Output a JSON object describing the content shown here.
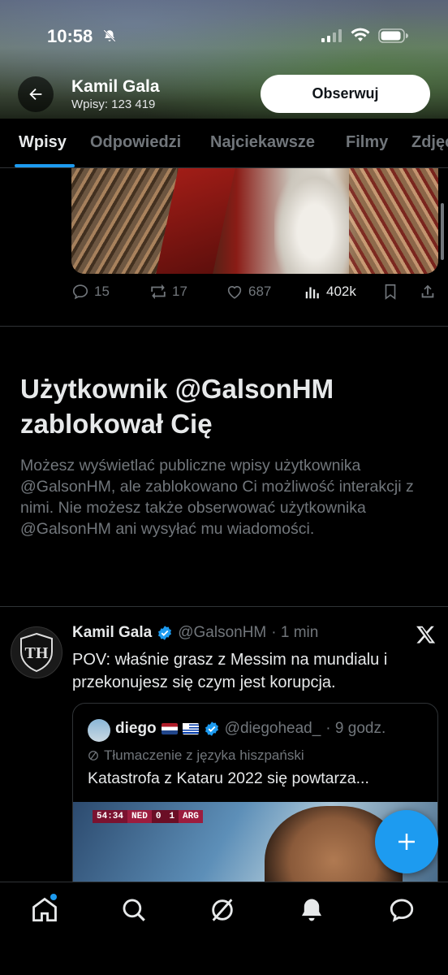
{
  "status_bar": {
    "time": "10:58"
  },
  "header": {
    "profile_name": "Kamil Gala",
    "post_count": "Wpisy: 123 419",
    "follow_label": "Obserwuj"
  },
  "tabs": [
    {
      "label": "Wpisy",
      "active": true
    },
    {
      "label": "Odpowiedzi",
      "active": false
    },
    {
      "label": "Najciekawsze",
      "active": false
    },
    {
      "label": "Filmy",
      "active": false
    },
    {
      "label": "Zdjęcia",
      "active": false
    }
  ],
  "first_post": {
    "replies": "15",
    "reposts": "17",
    "likes": "687",
    "views": "402k"
  },
  "blocked_notice": {
    "title": "Użytkownik @GalsonHM zablokował Cię",
    "body": "Możesz wyświetlać publiczne wpisy użytkownika @GalsonHM, ale zablokowano Ci możliwość interakcji z nimi. Nie możesz także obserwować użytkownika @GalsonHM ani wysyłać mu wiadomości."
  },
  "second_post": {
    "author_name": "Kamil Gala",
    "handle": "@GalsonHM",
    "time": "· 1 min",
    "text": "POV: właśnie grasz z Messim na mundialu i przekonujesz się czym jest korupcja.",
    "quote": {
      "author_name": "diego",
      "handle": "@diegohead_",
      "time": "· 9 godz.",
      "translation_note": "Tłumaczenie z języka hiszpański",
      "text": "Katastrofa z Kataru 2022 się powtarza...",
      "scoreboard": {
        "clock": "54:34",
        "home": "NED",
        "home_score": "0",
        "away_score": "1",
        "away": "ARG"
      }
    }
  },
  "icons": {
    "back": "arrow-left-icon",
    "verified": "verified-badge-icon",
    "platform": "x-logo-icon",
    "compose": "plus-icon"
  },
  "colors": {
    "accent": "#1d9bf0",
    "background": "#000000",
    "muted": "#71767b",
    "text": "#e7e9ea"
  }
}
